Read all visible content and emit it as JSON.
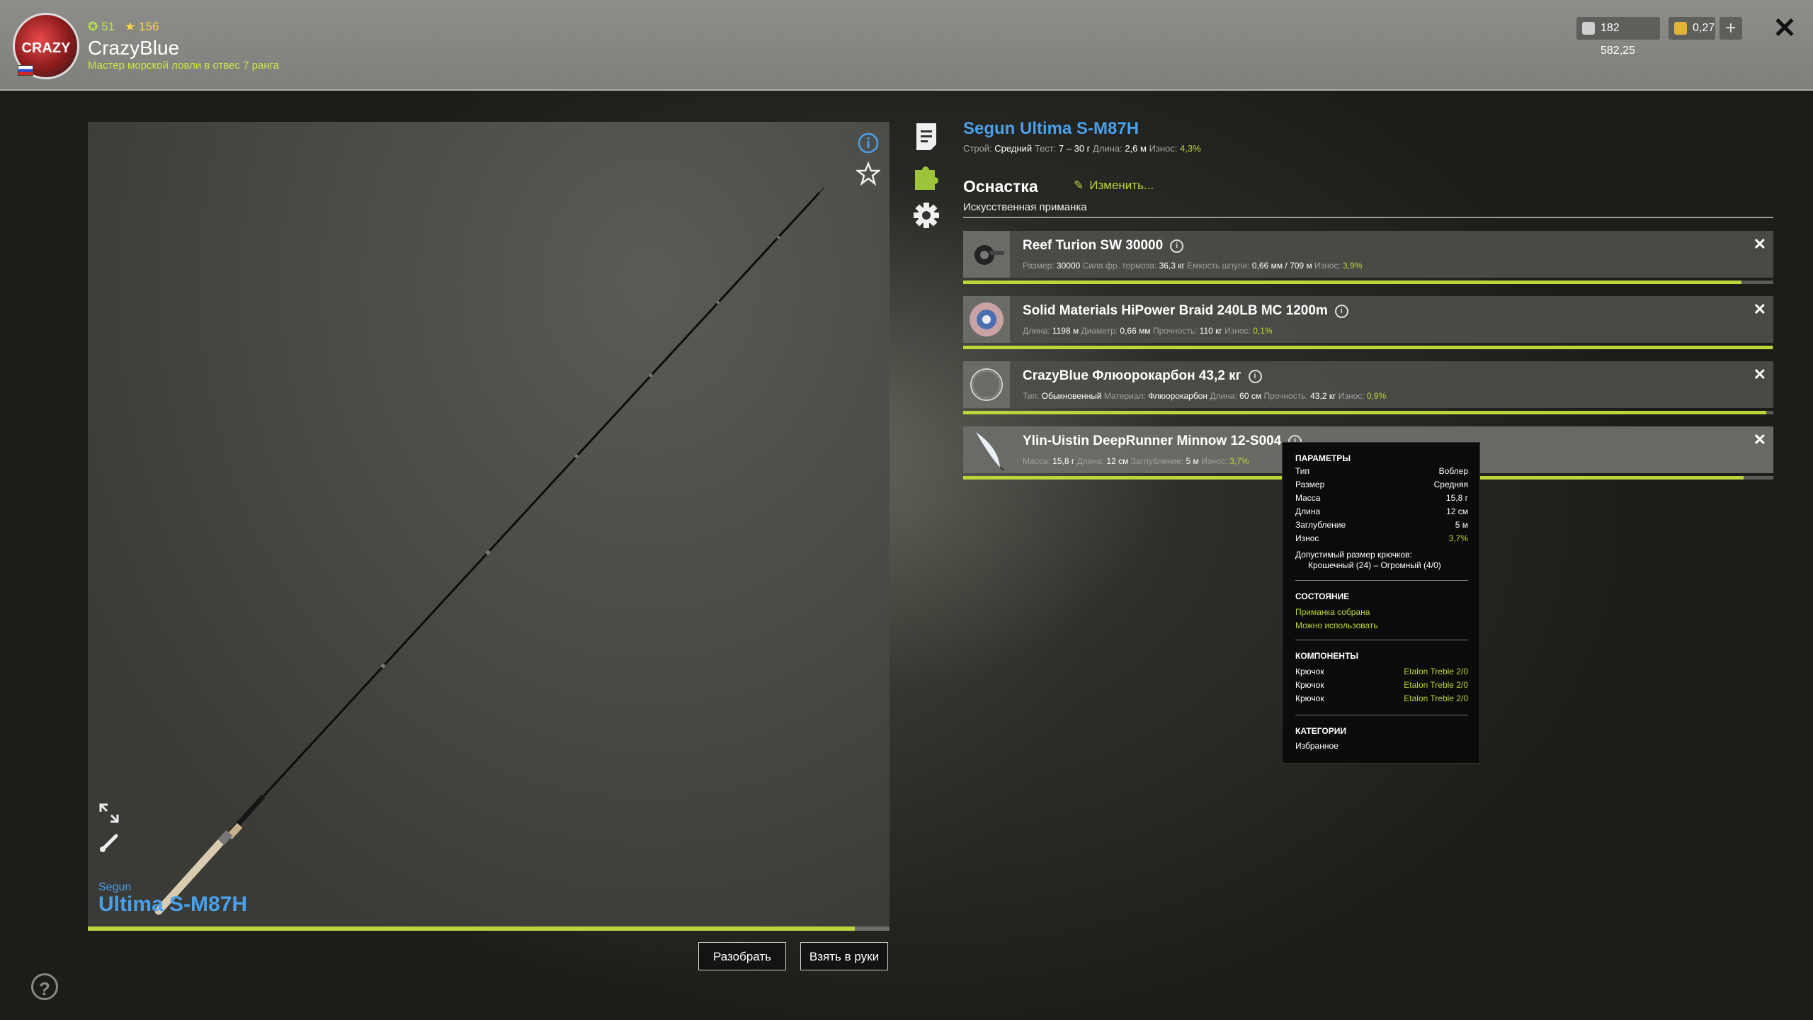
{
  "player": {
    "rating": "51",
    "stars": "156",
    "name": "CrazyBlue",
    "title": "Мастер морской ловли в отвес 7 ранга",
    "logo_text": "CRAZY F&T"
  },
  "currency": {
    "silver": "182 582,25",
    "gold": "0,27"
  },
  "rod": {
    "brand": "Segun",
    "name": "Ultima S-M87H",
    "wear_fraction": 0.957,
    "buttons": {
      "disassemble": "Разобрать",
      "take": "Взять в руки"
    }
  },
  "item": {
    "title": "Segun Ultima S-M87H",
    "stats": [
      {
        "label": "Строй:",
        "value": "Средний"
      },
      {
        "label": "Тест:",
        "value": "7 – 30 г"
      },
      {
        "label": "Длина:",
        "value": "2,6 м"
      },
      {
        "label": "Износ:",
        "value": "4,3%",
        "wear": true
      }
    ]
  },
  "tackle": {
    "title": "Оснастка",
    "edit": "Изменить...",
    "subtitle": "Искусственная приманка",
    "rows": [
      {
        "name": "Reef Turion SW 30000",
        "stats": [
          {
            "label": "Размер:",
            "value": "30000"
          },
          {
            "label": "Сила фр. тормоза:",
            "value": "36,3 кг"
          },
          {
            "label": "Емкость шпули:",
            "value": "0,66 мм / 709 м"
          },
          {
            "label": "Износ:",
            "value": "3,9%",
            "wear": true
          }
        ],
        "bar": 0.961
      },
      {
        "name": "Solid Materials HiPower Braid 240LB MC 1200m",
        "stats": [
          {
            "label": "Длина:",
            "value": "1198 м"
          },
          {
            "label": "Диаметр:",
            "value": "0,66 мм"
          },
          {
            "label": "Прочность:",
            "value": "110 кг"
          },
          {
            "label": "Износ:",
            "value": "0,1%",
            "wear": true
          }
        ],
        "bar": 0.999
      },
      {
        "name": "CrazyBlue Флюорокарбон 43,2 кг",
        "stats": [
          {
            "label": "Тип:",
            "value": "Обыкновенный"
          },
          {
            "label": "Материал:",
            "value": "Флюорокарбон"
          },
          {
            "label": "Длина:",
            "value": "60 см"
          },
          {
            "label": "Прочность:",
            "value": "43,2 кг"
          },
          {
            "label": "Износ:",
            "value": "0,9%",
            "wear": true
          }
        ],
        "bar": 0.991
      },
      {
        "name": "Ylin-Uistin DeepRunner Minnow 12-S004",
        "stats": [
          {
            "label": "Масса:",
            "value": "15,8 г"
          },
          {
            "label": "Длина:",
            "value": "12 см"
          },
          {
            "label": "Заглубление:",
            "value": "5 м"
          },
          {
            "label": "Износ:",
            "value": "3,7%",
            "wear": true
          }
        ],
        "bar": 0.963
      }
    ]
  },
  "tooltip": {
    "params_title": "ПАРАМЕТРЫ",
    "params": [
      {
        "k": "Тип",
        "v": "Воблер"
      },
      {
        "k": "Размер",
        "v": "Средняя"
      },
      {
        "k": "Масса",
        "v": "15,8 г"
      },
      {
        "k": "Длина",
        "v": "12 см"
      },
      {
        "k": "Заглубление",
        "v": "5 м"
      },
      {
        "k": "Износ",
        "v": "3,7%",
        "wear": true
      }
    ],
    "hook_label": "Допустимый размер крючков:",
    "hook_range": "Крошечный (24) – Огромный (4/0)",
    "state_title": "СОСТОЯНИЕ",
    "state": [
      "Приманка собрана",
      "Можно использовать"
    ],
    "components_title": "КОМПОНЕНТЫ",
    "components": [
      {
        "k": "Крючок",
        "v": "Etalon Treble 2/0"
      },
      {
        "k": "Крючок",
        "v": "Etalon Treble 2/0"
      },
      {
        "k": "Крючок",
        "v": "Etalon Treble 2/0"
      }
    ],
    "categories_title": "КАТЕГОРИИ",
    "categories": "Избранное"
  },
  "icons": {
    "info": "info-icon",
    "favorite": "star-icon",
    "expand": "expand-icon",
    "paint": "brush-icon",
    "details_tab": "document-icon",
    "tackle_tab": "puzzle-icon",
    "settings_tab": "gear-icon",
    "help": "help-icon",
    "close": "close-icon"
  },
  "colors": {
    "accent_blue": "#4aa0e8",
    "wear_green": "#b9d63a"
  }
}
